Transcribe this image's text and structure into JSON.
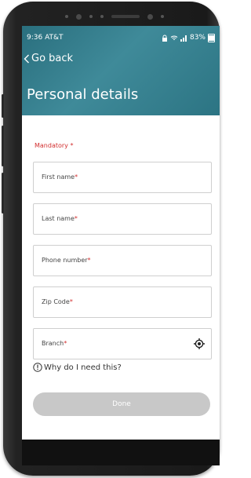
{
  "status_bar": {
    "time_carrier": "9:36 AT&T",
    "battery_percent": "83%"
  },
  "header": {
    "back_label": "Go back",
    "title": "Personal details"
  },
  "form": {
    "mandatory_label": "Mandatory",
    "required_marker": "*",
    "fields": [
      {
        "label": "First name"
      },
      {
        "label": "Last name"
      },
      {
        "label": "Phone number"
      },
      {
        "label": "Zip Code"
      },
      {
        "label": "Branch"
      }
    ],
    "why_link": "Why do I need this?",
    "done_label": "Done"
  },
  "colors": {
    "header_teal": "#2f7a89",
    "required_red": "#d22f2f",
    "disabled_button": "#c8c8c8"
  }
}
